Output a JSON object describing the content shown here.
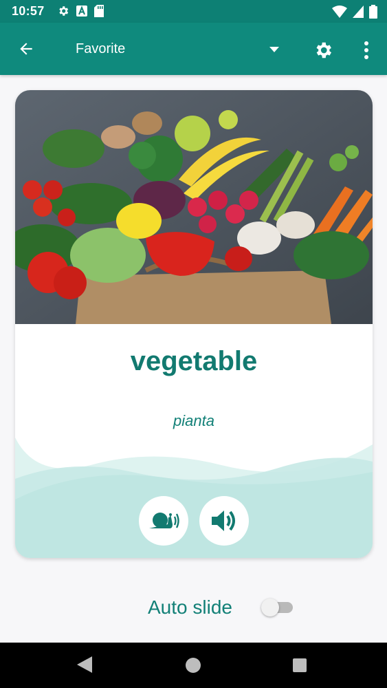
{
  "status_bar": {
    "time": "10:57",
    "icons_left": [
      "settings-icon",
      "font-a-icon",
      "sd-card-icon"
    ],
    "icons_right": [
      "wifi-icon",
      "cell-signal-icon",
      "battery-icon"
    ]
  },
  "app_bar": {
    "title": "Favorite",
    "back_icon": "arrow-back-icon",
    "dropdown_icon": "dropdown-arrow-icon",
    "settings_icon": "gear-icon",
    "more_icon": "more-vert-icon",
    "color": "#0f8a7d"
  },
  "card": {
    "image_label": "vegetables in paper bag",
    "word": "vegetable",
    "translation": "pianta",
    "slow_audio_icon": "snail-sound-icon",
    "audio_icon": "speaker-icon",
    "accent_color": "#127a70"
  },
  "auto_slide": {
    "label": "Auto slide",
    "enabled": false
  },
  "nav_bar": {
    "back_icon": "nav-back-icon",
    "home_icon": "nav-home-icon",
    "recents_icon": "nav-recents-icon"
  }
}
